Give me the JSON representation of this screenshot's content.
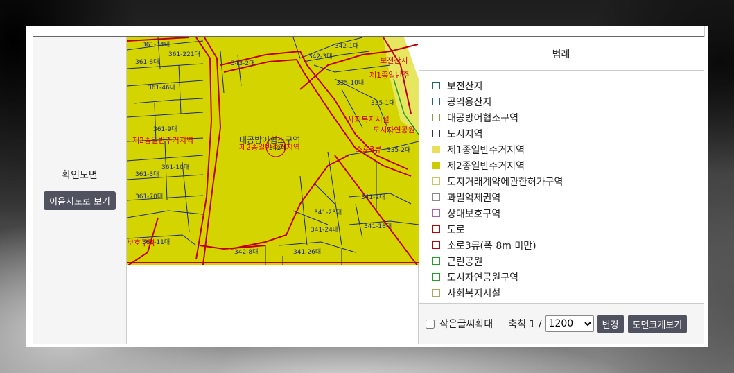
{
  "section": {
    "label": "확인도면",
    "view_button": "이음지도로 보기"
  },
  "map": {
    "parcels": [
      "361-34대",
      "361-221대",
      "361-8대",
      "361-46대",
      "361-9대",
      "361-3대",
      "361-10대",
      "361-70대",
      "361-11대",
      "343-2대",
      "342-8대",
      "341-26대",
      "341-23대",
      "341-24대",
      "341-2대",
      "341-18대",
      "335-10대",
      "335-1대",
      "335-2대",
      "342-1대",
      "342-3대"
    ],
    "red_labels": [
      "제2종일반주거지역",
      "제2종일반주거지역",
      "제1종일반주",
      "사회복지시설",
      "소로3류",
      "보호구역",
      "보전산지",
      "대공방어협조구역",
      "도시자연공원"
    ],
    "center_label": "대공방어협조구역",
    "center_parcel": "342대"
  },
  "legend": {
    "title": "범례",
    "items": [
      {
        "label": "보전산지",
        "color": "#ffffff",
        "border": "#1d6b5a"
      },
      {
        "label": "공익용산지",
        "color": "#ffffff",
        "border": "#1d6b5a"
      },
      {
        "label": "대공방어협조구역",
        "color": "#ffffff",
        "border": "#a08c4a"
      },
      {
        "label": "도시지역",
        "color": "#ffffff",
        "border": "#333333"
      },
      {
        "label": "제1종일반주거지역",
        "color": "#e8e05a",
        "border": "#e8e05a"
      },
      {
        "label": "제2종일반주거지역",
        "color": "#cccc00",
        "border": "#cccc00"
      },
      {
        "label": "토지거래계약에관한허가구역",
        "color": "#ffffff",
        "border": "#c8c860"
      },
      {
        "label": "과밀억제권역",
        "color": "#ffffff",
        "border": "#888888"
      },
      {
        "label": "상대보호구역",
        "color": "#ffffff",
        "border": "#b060a0"
      },
      {
        "label": "도로",
        "color": "#ffffff",
        "border": "#c00000"
      },
      {
        "label": "소로3류(폭 8m 미만)",
        "color": "#ffffff",
        "border": "#c00000"
      },
      {
        "label": "근린공원",
        "color": "#ffffff",
        "border": "#20a020"
      },
      {
        "label": "도시자연공원구역",
        "color": "#ffffff",
        "border": "#20a020"
      },
      {
        "label": "사회복지시설",
        "color": "#ffffff",
        "border": "#a8a860"
      }
    ]
  },
  "controls": {
    "small_text_label": "작은글씨확대",
    "scale_label": "축척 1 /",
    "scale_value": "1200",
    "change_button": "변경",
    "enlarge_button": "도면크게보기"
  },
  "colors": {
    "zone_yellow": "#d4d400",
    "road_red": "#c00000",
    "button_dark": "#50535f"
  }
}
